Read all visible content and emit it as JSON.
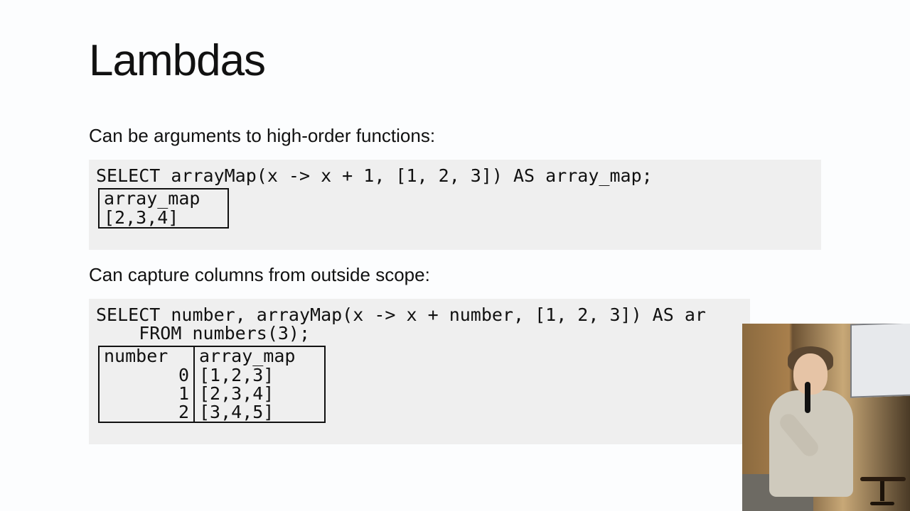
{
  "title": "Lambdas",
  "section1": {
    "lead": "Can be arguments to high-order functions:",
    "code": "SELECT arrayMap(x -> x + 1, [1, 2, 3]) AS array_map;",
    "result": {
      "header": "array_map",
      "value": "[2,3,4]"
    }
  },
  "section2": {
    "lead": "Can capture columns from outside scope:",
    "code_line1": "SELECT number, arrayMap(x -> x + number, [1, 2, 3]) AS ar",
    "code_line2": "    FROM numbers(3);",
    "result": {
      "headers": [
        "number",
        "array_map"
      ],
      "rows": [
        {
          "number": "0",
          "array_map": "[1,2,3]"
        },
        {
          "number": "1",
          "array_map": "[2,3,4]"
        },
        {
          "number": "2",
          "array_map": "[3,4,5]"
        }
      ]
    }
  }
}
